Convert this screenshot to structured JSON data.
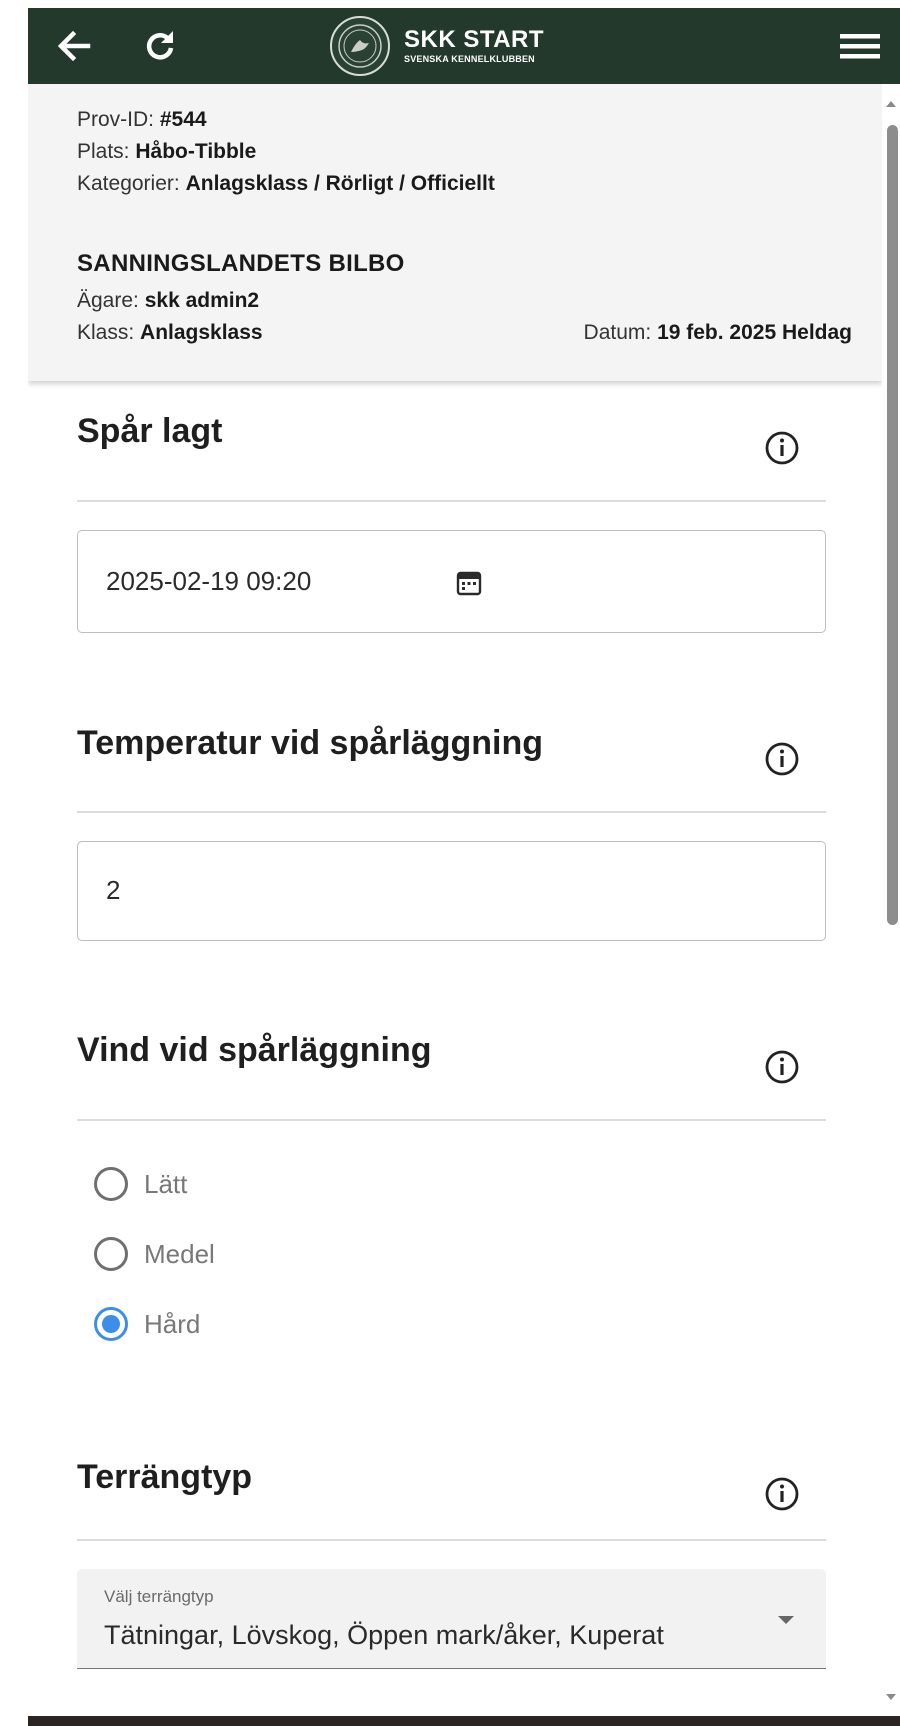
{
  "header": {
    "logo_title": "SKK START",
    "logo_subtitle": "SVENSKA KENNELKLUBBEN",
    "icons": [
      "back-arrow-icon",
      "refresh-icon",
      "menu-icon"
    ],
    "color": "#23392c"
  },
  "info": {
    "prov_id_label": "Prov-ID:",
    "prov_id_value": "#544",
    "plats_label": "Plats:",
    "plats_value": "Håbo-Tibble",
    "kategorier_label": "Kategorier:",
    "kategorier_value": "Anlagsklass / Rörligt / Officiellt",
    "dog_name": "SANNINGSLANDETS BILBO",
    "agare_label": "Ägare:",
    "agare_value": "skk admin2",
    "klass_label": "Klass:",
    "klass_value": "Anlagsklass",
    "datum_label": "Datum:",
    "datum_value": "19 feb. 2025 Heldag"
  },
  "sections": {
    "spar_lagt": {
      "title": "Spår lagt",
      "value": "2025-02-19 09:20"
    },
    "temperatur": {
      "title": "Temperatur vid spårläggning",
      "value": "2"
    },
    "vind": {
      "title": "Vind vid spårläggning",
      "options": [
        "Lätt",
        "Medel",
        "Hård"
      ],
      "selected": "Hård"
    },
    "terrang": {
      "title": "Terrängtyp",
      "select_label": "Välj terrängtyp",
      "select_value": "Tätningar, Lövskog, Öppen mark/åker, Kuperat"
    }
  },
  "colors": {
    "accent": "#3d8ee8",
    "header_bg": "#23392c"
  }
}
